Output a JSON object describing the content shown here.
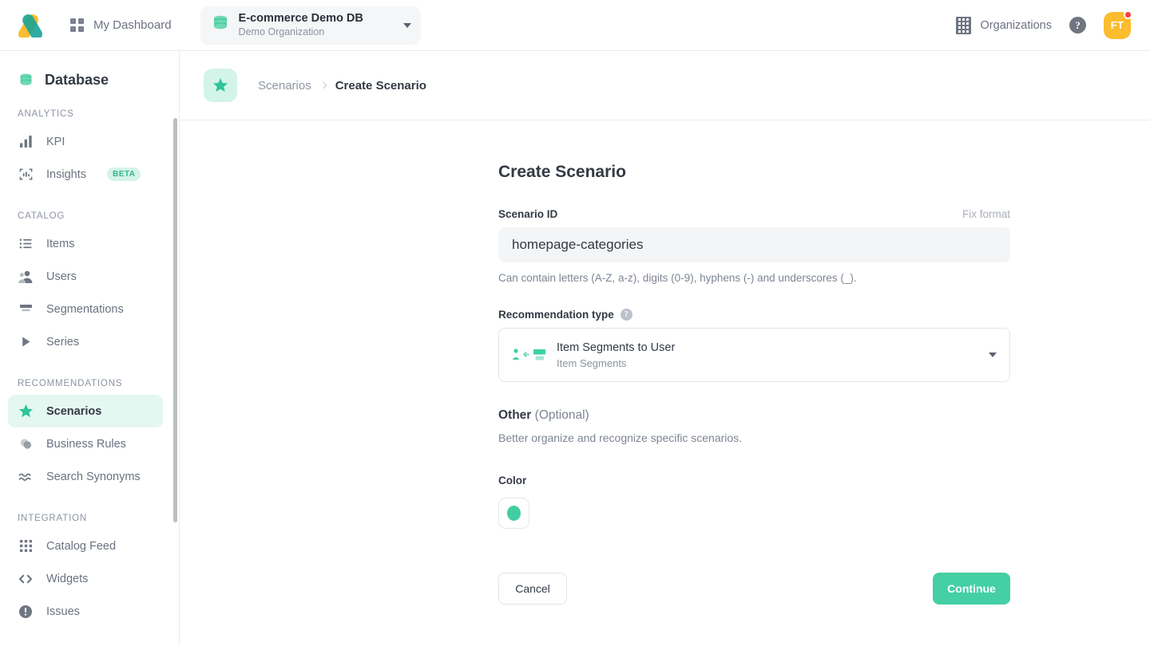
{
  "topbar": {
    "logo_icon": "logo-icon",
    "dashboard": {
      "label": "My Dashboard",
      "icon": "grid-icon"
    },
    "db_selector": {
      "icon": "database-icon",
      "title": "E-commerce Demo DB",
      "subtitle": "Demo Organization",
      "caret_icon": "chevron-down-icon"
    },
    "organizations": {
      "label": "Organizations",
      "icon": "building-icon"
    },
    "help": {
      "label": "?",
      "icon": "help-circle-icon"
    },
    "avatar": {
      "initials": "FT",
      "has_notification": true
    }
  },
  "sidebar": {
    "header": {
      "label": "Database",
      "icon": "database-icon"
    },
    "sections": [
      {
        "title": "ANALYTICS",
        "items": [
          {
            "label": "KPI",
            "icon": "bar-chart-icon",
            "active": false,
            "badge": null
          },
          {
            "label": "Insights",
            "icon": "insights-icon",
            "active": false,
            "badge": "BETA"
          }
        ]
      },
      {
        "title": "CATALOG",
        "items": [
          {
            "label": "Items",
            "icon": "list-icon",
            "active": false,
            "badge": null
          },
          {
            "label": "Users",
            "icon": "users-icon",
            "active": false,
            "badge": null
          },
          {
            "label": "Segmentations",
            "icon": "segmentations-icon",
            "active": false,
            "badge": null
          },
          {
            "label": "Series",
            "icon": "play-triangle-icon",
            "active": false,
            "badge": null
          }
        ]
      },
      {
        "title": "RECOMMENDATIONS",
        "items": [
          {
            "label": "Scenarios",
            "icon": "star-icon",
            "active": true,
            "badge": null
          },
          {
            "label": "Business Rules",
            "icon": "overlap-circles-icon",
            "active": false,
            "badge": null
          },
          {
            "label": "Search Synonyms",
            "icon": "approx-equal-icon",
            "active": false,
            "badge": null
          }
        ]
      },
      {
        "title": "INTEGRATION",
        "items": [
          {
            "label": "Catalog Feed",
            "icon": "apps-grid-icon",
            "active": false,
            "badge": null
          },
          {
            "label": "Widgets",
            "icon": "code-brackets-icon",
            "active": false,
            "badge": null
          },
          {
            "label": "Issues",
            "icon": "exclamation-circle-icon",
            "active": false,
            "badge": null
          }
        ]
      }
    ]
  },
  "breadcrumb": {
    "badge_icon": "star-icon",
    "parent": "Scenarios",
    "separator_icon": "chevron-right-icon",
    "current": "Create Scenario"
  },
  "form": {
    "title": "Create Scenario",
    "scenario_id": {
      "label": "Scenario ID",
      "action": "Fix format",
      "value": "homepage-categories",
      "placeholder": "",
      "hint": "Can contain letters (A-Z, a-z), digits (0-9), hyphens (-) and underscores (_)."
    },
    "recommendation_type": {
      "label": "Recommendation type",
      "tooltip_icon": "help-circle-icon",
      "selected": "Item Segments to User",
      "selected_sub": "Item Segments",
      "option_icon": "item-segments-to-user-icon",
      "caret_icon": "chevron-down-icon"
    },
    "other": {
      "title": "Other",
      "optional": "(Optional)",
      "description": "Better organize and recognize specific scenarios.",
      "color_label": "Color",
      "color_value": "#42cda2"
    },
    "buttons": {
      "cancel": "Cancel",
      "continue": "Continue"
    }
  },
  "theme": {
    "accent_green": "#44cfa4",
    "accent_light": "#e4f7f0",
    "avatar_yellow": "#fbbc2e",
    "notification_red": "#fc3d39"
  }
}
